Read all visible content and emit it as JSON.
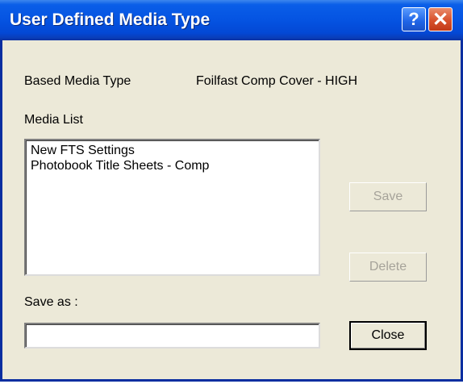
{
  "window": {
    "title": "User Defined Media Type",
    "help_symbol": "?",
    "close_symbol": "✕"
  },
  "based_media": {
    "label": "Based Media Type",
    "value": "Foilfast Comp Cover - HIGH"
  },
  "media_list": {
    "label": "Media List",
    "items": [
      "New FTS Settings",
      "Photobook Title Sheets - Comp"
    ]
  },
  "buttons": {
    "save": "Save",
    "delete": "Delete",
    "close": "Close"
  },
  "save_as": {
    "label": "Save as :",
    "value": ""
  },
  "colors": {
    "titlebar": "#0554e2",
    "dialog_bg": "#ece9d8",
    "close_button": "#d8512c"
  }
}
